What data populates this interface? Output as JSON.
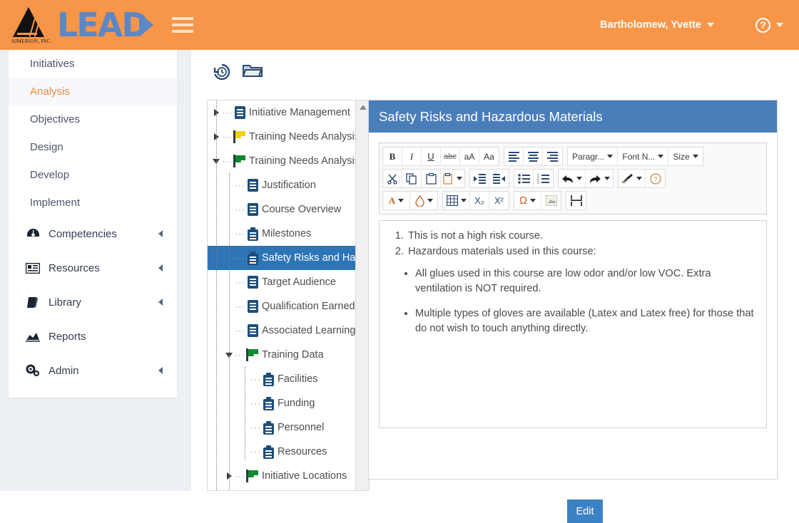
{
  "header": {
    "logo_word": "LEAD",
    "logo_company": "AIMERION, INC.",
    "menu_icon": "hamburger-icon",
    "user_name": "Bartholomew, Yvette",
    "help_glyph": "?"
  },
  "sidebar": {
    "items": [
      {
        "label": "Initiatives",
        "active": false
      },
      {
        "label": "Analysis",
        "active": true
      },
      {
        "label": "Objectives",
        "active": false
      },
      {
        "label": "Design",
        "active": false
      },
      {
        "label": "Develop",
        "active": false
      },
      {
        "label": "Implement",
        "active": false
      }
    ],
    "groups": [
      {
        "label": "Competencies",
        "icon": "gauge-icon",
        "expandable": true
      },
      {
        "label": "Resources",
        "icon": "id-card-icon",
        "expandable": true
      },
      {
        "label": "Library",
        "icon": "book-icon",
        "expandable": true
      },
      {
        "label": "Reports",
        "icon": "chart-icon",
        "expandable": false
      },
      {
        "label": "Admin",
        "icon": "gears-icon",
        "expandable": true
      }
    ]
  },
  "toolbar_actions": [
    {
      "name": "history-icon",
      "title": "History"
    },
    {
      "name": "folder-icon",
      "title": "Folder"
    }
  ],
  "tree": {
    "nodes": [
      {
        "label": "Initiative Management",
        "icon": "document-icon",
        "indent": 0,
        "toggle": "collapsed",
        "selected": false
      },
      {
        "label": "Training Needs Analysis",
        "icon": "flag-yellow-icon",
        "indent": 0,
        "toggle": "collapsed",
        "selected": false
      },
      {
        "label": "Training Needs Analysis",
        "icon": "flag-green-icon",
        "indent": 0,
        "toggle": "expanded",
        "selected": false
      },
      {
        "label": "Justification",
        "icon": "document-icon",
        "indent": 1,
        "toggle": "leaf",
        "selected": false
      },
      {
        "label": "Course Overview",
        "icon": "document-icon",
        "indent": 1,
        "toggle": "leaf",
        "selected": false
      },
      {
        "label": "Milestones",
        "icon": "clipboard-icon",
        "indent": 1,
        "toggle": "leaf",
        "selected": false
      },
      {
        "label": "Safety Risks and Haz",
        "icon": "clipboard-icon",
        "indent": 1,
        "toggle": "leaf",
        "selected": true
      },
      {
        "label": "Target Audience",
        "icon": "document-icon",
        "indent": 1,
        "toggle": "leaf",
        "selected": false
      },
      {
        "label": "Qualification Earned",
        "icon": "document-icon",
        "indent": 1,
        "toggle": "leaf",
        "selected": false
      },
      {
        "label": "Associated Learning E",
        "icon": "document-icon",
        "indent": 1,
        "toggle": "leaf",
        "selected": false
      },
      {
        "label": "Training Data",
        "icon": "flag-green-icon",
        "indent": 1,
        "toggle": "expanded",
        "selected": false
      },
      {
        "label": "Facilities",
        "icon": "clipboard-icon",
        "indent": 2,
        "toggle": "leaf",
        "selected": false
      },
      {
        "label": "Funding",
        "icon": "clipboard-icon",
        "indent": 2,
        "toggle": "leaf",
        "selected": false
      },
      {
        "label": "Personnel",
        "icon": "clipboard-icon",
        "indent": 2,
        "toggle": "leaf",
        "selected": false
      },
      {
        "label": "Resources",
        "icon": "clipboard-icon",
        "indent": 2,
        "toggle": "leaf",
        "selected": false
      },
      {
        "label": "Initiative Locations",
        "icon": "flag-green-icon",
        "indent": 1,
        "toggle": "collapsed",
        "selected": false
      }
    ],
    "scrollbar": {
      "up_arrow": "scroll-up-arrow"
    }
  },
  "editor": {
    "title": "Safety Risks and Hazardous Materials",
    "toolbar": {
      "row1": [
        {
          "name": "bold-button",
          "label": "B"
        },
        {
          "name": "italic-button",
          "label": "I"
        },
        {
          "name": "underline-button",
          "label": "U"
        },
        {
          "name": "strikethrough-button",
          "label": "abc"
        },
        {
          "name": "uppercase-button",
          "label": "aA"
        },
        {
          "name": "font-case-button",
          "label": "Aa"
        }
      ],
      "row1b": [
        {
          "name": "align-left-button",
          "label": "align-left-icon"
        },
        {
          "name": "align-center-button",
          "label": "align-center-icon"
        },
        {
          "name": "align-right-button",
          "label": "align-right-icon"
        }
      ],
      "row1c": [
        {
          "name": "paragraph-format-select",
          "label": "Paragr..."
        },
        {
          "name": "font-name-select",
          "label": "Font N..."
        },
        {
          "name": "font-size-select",
          "label": "Size"
        }
      ],
      "row2": [
        {
          "name": "cut-button",
          "label": "scissors-icon"
        },
        {
          "name": "copy-button",
          "label": "copy-icon"
        },
        {
          "name": "paste-button",
          "label": "paste-icon"
        },
        {
          "name": "paste-options-button",
          "label": "paste-dropdown-icon"
        }
      ],
      "row2b": [
        {
          "name": "indent-button",
          "label": "indent-icon"
        },
        {
          "name": "outdent-button",
          "label": "outdent-icon"
        }
      ],
      "row2c": [
        {
          "name": "bullet-list-button",
          "label": "bullet-list-icon"
        },
        {
          "name": "numbered-list-button",
          "label": "numbered-list-icon"
        }
      ],
      "row2d": [
        {
          "name": "undo-button",
          "label": "undo-icon"
        },
        {
          "name": "redo-button",
          "label": "redo-icon"
        }
      ],
      "row2e": [
        {
          "name": "format-painter-button",
          "label": "format-painter-icon"
        },
        {
          "name": "help-button",
          "label": "?"
        }
      ],
      "row3": [
        {
          "name": "text-color-button",
          "label": "A"
        },
        {
          "name": "highlight-color-button",
          "label": "droplet-icon"
        }
      ],
      "row3b": [
        {
          "name": "table-button",
          "label": "table-icon"
        },
        {
          "name": "subscript-button",
          "label": "X₂"
        },
        {
          "name": "superscript-button",
          "label": "X²"
        }
      ],
      "row3c": [
        {
          "name": "special-character-button",
          "label": "Ω"
        },
        {
          "name": "insert-image-button",
          "label": "image-icon"
        }
      ],
      "row3d": [
        {
          "name": "page-break-button",
          "label": "page-break-icon"
        }
      ]
    },
    "content": {
      "ordered": [
        "This is not a high risk course.",
        "Hazardous materials used in this course:"
      ],
      "bullets": [
        "All glues used in this course are low odor and/or low VOC. Extra ventilation is NOT required.",
        "Multiple types of gloves are available (Latex and Latex free) for those that do not wish to touch anything directly."
      ]
    },
    "edit_label": "Edit"
  },
  "colors": {
    "brand_orange": "#f79548",
    "logo_blue": "#5b87c7",
    "panel_blue": "#4a7ebb",
    "selection_blue": "#2e75b6",
    "button_blue": "#3b82c4",
    "active_nav": "#f08a3c"
  }
}
